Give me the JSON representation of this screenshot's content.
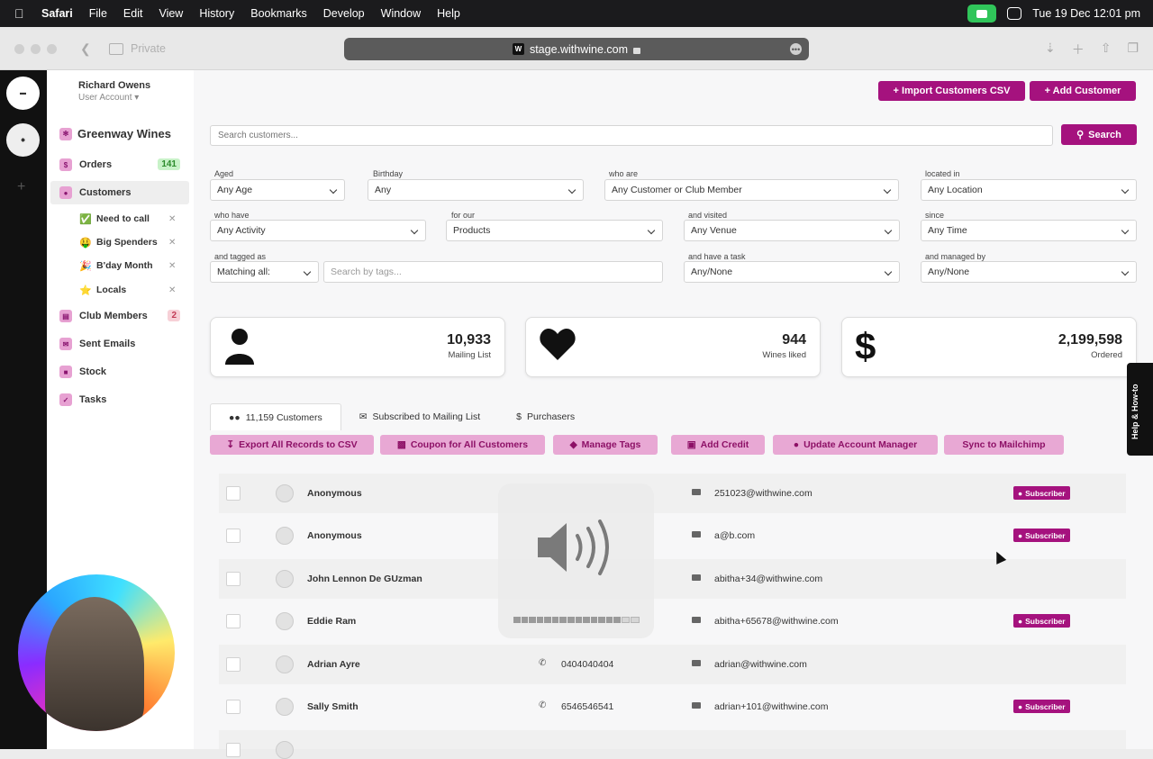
{
  "menubar": {
    "app": "Safari",
    "items": [
      "File",
      "Edit",
      "View",
      "History",
      "Bookmarks",
      "Develop",
      "Window",
      "Help"
    ],
    "clock": "Tue 19 Dec  12:01 pm"
  },
  "browser": {
    "private_label": "Private",
    "url": "stage.withwine.com",
    "favicon": "W"
  },
  "user": {
    "name": "Richard Owens",
    "role": "User Account"
  },
  "sidebar": {
    "brand": "Greenway Wines",
    "items": [
      {
        "label": "Orders",
        "badge": "141"
      },
      {
        "label": "Customers"
      },
      {
        "label": "Club Members",
        "badge": "2"
      },
      {
        "label": "Sent Emails"
      },
      {
        "label": "Stock"
      },
      {
        "label": "Tasks"
      }
    ],
    "segments": [
      {
        "emoji": "✅",
        "label": "Need to call"
      },
      {
        "emoji": "🤑",
        "label": "Big Spenders"
      },
      {
        "emoji": "🎉",
        "label": "B'day Month"
      },
      {
        "emoji": "⭐",
        "label": "Locals"
      }
    ]
  },
  "header": {
    "import_label": "+ Import Customers CSV",
    "add_label": "+ Add Customer"
  },
  "search": {
    "placeholder": "Search customers...",
    "button": "Search"
  },
  "filters": {
    "aged": {
      "label": "Aged",
      "value": "Any Age"
    },
    "birthday": {
      "label": "Birthday",
      "value": "Any"
    },
    "who_are": {
      "label": "who are",
      "value": "Any Customer or Club Member"
    },
    "located_in": {
      "label": "located in",
      "value": "Any Location"
    },
    "who_have": {
      "label": "who have",
      "value": "Any Activity"
    },
    "for_our": {
      "label": "for our",
      "value": "Products"
    },
    "and_visited": {
      "label": "and visited",
      "value": "Any Venue"
    },
    "since": {
      "label": "since",
      "value": "Any Time"
    },
    "tagged_as": {
      "label": "and tagged as",
      "value": "Matching all:"
    },
    "tags_placeholder": "Search by tags...",
    "task": {
      "label": "and have a task",
      "value": "Any/None"
    },
    "managed_by": {
      "label": "and managed by",
      "value": "Any/None"
    }
  },
  "stats": [
    {
      "value": "10,933",
      "label": "Mailing List",
      "icon": "user-icon"
    },
    {
      "value": "944",
      "label": "Wines liked",
      "icon": "heart-icon"
    },
    {
      "value": "2,199,598",
      "label": "Ordered",
      "icon": "dollar-icon"
    }
  ],
  "tabs": [
    "11,159 Customers",
    "Subscribed to Mailing List",
    "Purchasers"
  ],
  "actions": [
    "Export All Records to CSV",
    "Coupon for All Customers",
    "Manage Tags",
    "Add Credit",
    "Update Account Manager",
    "Sync to Mailchimp"
  ],
  "subscriber_label": "Subscriber",
  "customers": [
    {
      "name": "Anonymous",
      "phone": "",
      "email": "251023@withwine.com",
      "subscriber": true
    },
    {
      "name": "Anonymous",
      "phone": "",
      "email": "a@b.com",
      "subscriber": true
    },
    {
      "name": "John Lennon De GUzman",
      "phone": "",
      "email": "abitha+34@withwine.com",
      "subscriber": false
    },
    {
      "name": "Eddie Ram",
      "phone": "",
      "email": "abitha+65678@withwine.com",
      "subscriber": true
    },
    {
      "name": "Adrian Ayre",
      "phone": "0404040404",
      "email": "adrian@withwine.com",
      "subscriber": false
    },
    {
      "name": "Sally Smith",
      "phone": "6546546541",
      "email": "adrian+101@withwine.com",
      "subscriber": true
    }
  ],
  "help_tab": "Help & How-to",
  "volume": {
    "level": 0.86
  },
  "colors": {
    "brand": "#a5127e",
    "brand_light": "#e8a8d4"
  }
}
